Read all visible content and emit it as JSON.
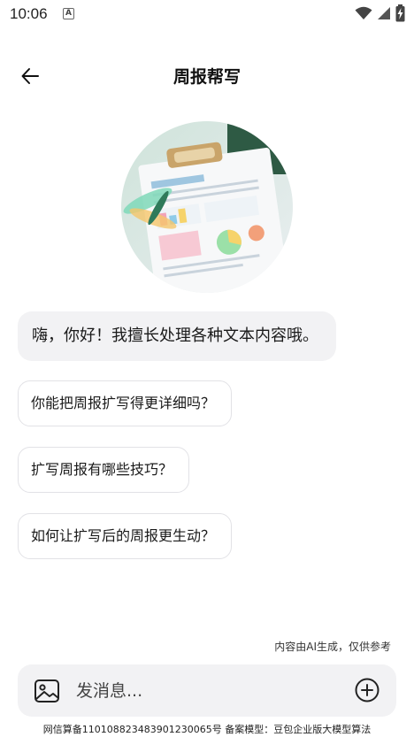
{
  "status_bar": {
    "time": "10:06",
    "notification_glyph": "A",
    "icons": [
      "wifi-icon",
      "signal-icon",
      "battery-charging-icon"
    ]
  },
  "header": {
    "title": "周报帮写",
    "back_icon": "arrow-left-icon"
  },
  "chat": {
    "greeting": "嗨，你好！我擅长处理各种文本内容哦。",
    "suggestions": [
      "你能把周报扩写得更详细吗？",
      "扩写周报有哪些技巧？",
      "如何让扩写后的周报更生动？"
    ]
  },
  "ai_notice": "内容由AI生成，仅供参考",
  "input_bar": {
    "placeholder": "发消息...",
    "image_icon": "image-icon",
    "add_icon": "plus-circle-icon"
  },
  "footer": {
    "text": "网信算备110108823483901230065号 备案模型：豆包企业版大模型算法"
  },
  "colors": {
    "bubble_bg": "#f2f2f4",
    "suggestion_border": "#e2e2e6",
    "text": "#1a1a1a"
  }
}
